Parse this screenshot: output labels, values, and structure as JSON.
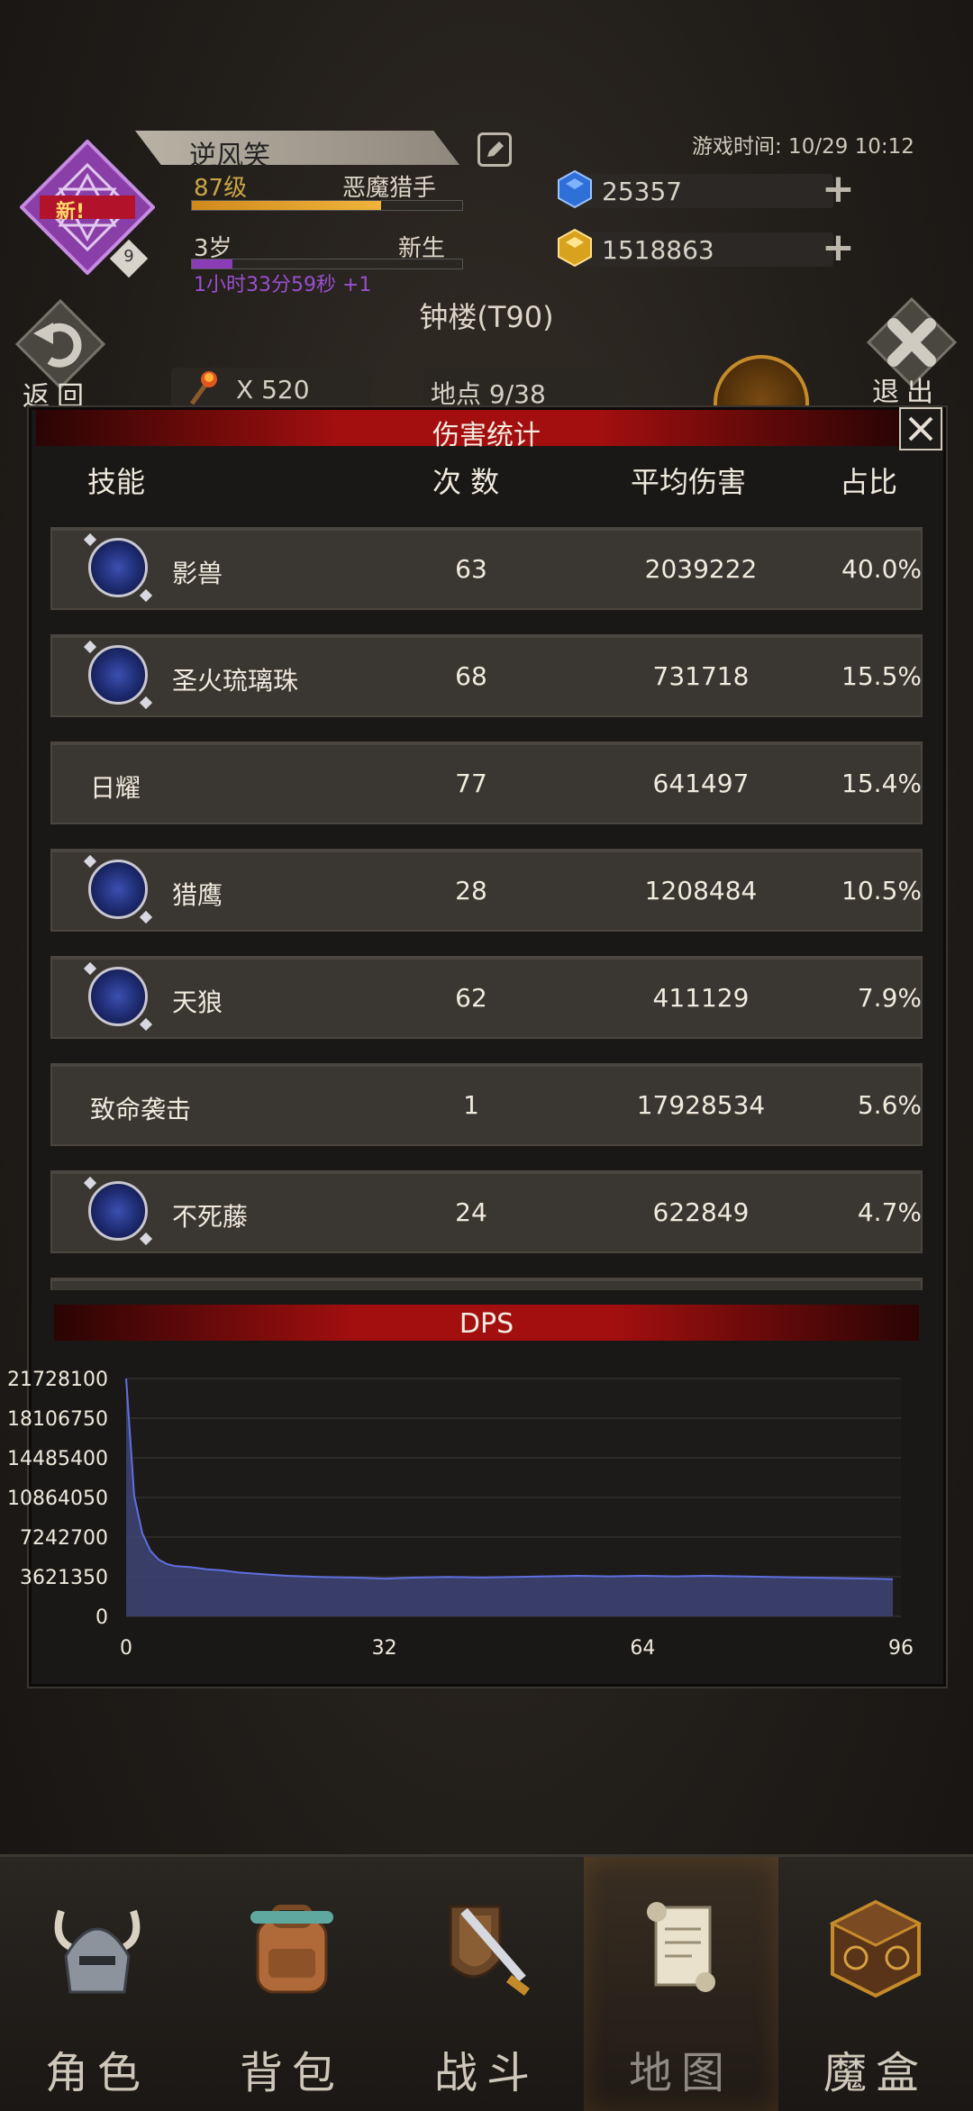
{
  "header": {
    "badge_new": "新!",
    "badge_num": "9",
    "player_name": "逆风笑",
    "level": "87级",
    "class_name": "恶魔猎手",
    "xp_fraction": 0.7,
    "age": "3岁",
    "stage": "新生",
    "age_fraction": 0.15,
    "timer": "1小时33分59秒 +1",
    "game_time": "游戏时间: 10/29 10:12",
    "gems": "25357",
    "gold": "1518863",
    "location_name": "钟楼(T90)",
    "back_label": "返回",
    "exit_label": "退出",
    "torch_count": "X 520",
    "location_count": "地点 9/38"
  },
  "panel": {
    "title": "伤害统计",
    "columns": {
      "skill": "技能",
      "count": "次 数",
      "avg": "平均伤害",
      "pct": "占比"
    },
    "rows": [
      {
        "name": "影兽",
        "count": "63",
        "avg": "2039222",
        "pct": "40.0%",
        "icon": "shadow-beast-icon",
        "has_icon": true
      },
      {
        "name": "圣火琉璃珠",
        "count": "68",
        "avg": "731718",
        "pct": "15.5%",
        "icon": "holy-fire-orb-icon",
        "has_icon": true
      },
      {
        "name": "日耀",
        "count": "77",
        "avg": "641497",
        "pct": "15.4%",
        "icon": "",
        "has_icon": false
      },
      {
        "name": "猎鹰",
        "count": "28",
        "avg": "1208484",
        "pct": "10.5%",
        "icon": "falcon-icon",
        "has_icon": true
      },
      {
        "name": "天狼",
        "count": "62",
        "avg": "411129",
        "pct": "7.9%",
        "icon": "sky-wolf-icon",
        "has_icon": true
      },
      {
        "name": "致命袭击",
        "count": "1",
        "avg": "17928534",
        "pct": "5.6%",
        "icon": "",
        "has_icon": false
      },
      {
        "name": "不死藤",
        "count": "24",
        "avg": "622849",
        "pct": "4.7%",
        "icon": "undying-vine-icon",
        "has_icon": true
      }
    ]
  },
  "dps": {
    "title": "DPS"
  },
  "chart_data": {
    "type": "area",
    "title": "DPS",
    "xlabel": "",
    "ylabel": "",
    "xlim": [
      0,
      96
    ],
    "ylim": [
      0,
      21728100
    ],
    "x_ticks": [
      "0",
      "32",
      "64",
      "96"
    ],
    "y_ticks": [
      "0",
      "3621350",
      "7242700",
      "10864050",
      "14485400",
      "18106750",
      "21728100"
    ],
    "grid": true,
    "series": [
      {
        "x": [
          0,
          1,
          2,
          3,
          4,
          5,
          6,
          8,
          10,
          12,
          14,
          16,
          18,
          20,
          24,
          28,
          32,
          36,
          40,
          44,
          48,
          52,
          56,
          60,
          64,
          68,
          72,
          76,
          80,
          84,
          88,
          92,
          95
        ],
        "values": [
          21728100,
          11000000,
          7600000,
          6000000,
          5200000,
          4800000,
          4600000,
          4500000,
          4300000,
          4200000,
          4000000,
          3900000,
          3800000,
          3700000,
          3600000,
          3550000,
          3450000,
          3550000,
          3600000,
          3550000,
          3600000,
          3650000,
          3700000,
          3650000,
          3700000,
          3650000,
          3700000,
          3650000,
          3600000,
          3550000,
          3500000,
          3450000,
          3400000
        ]
      }
    ],
    "colors": {
      "line": "#5f6fe0",
      "fill": "#3c4270"
    }
  },
  "nav": {
    "items": [
      {
        "label": "角色",
        "icon": "helmet-icon"
      },
      {
        "label": "背包",
        "icon": "backpack-icon"
      },
      {
        "label": "战斗",
        "icon": "sword-shield-icon"
      },
      {
        "label": "地图",
        "icon": "scroll-map-icon"
      },
      {
        "label": "魔盒",
        "icon": "magic-box-icon"
      }
    ],
    "active_index": 3
  }
}
